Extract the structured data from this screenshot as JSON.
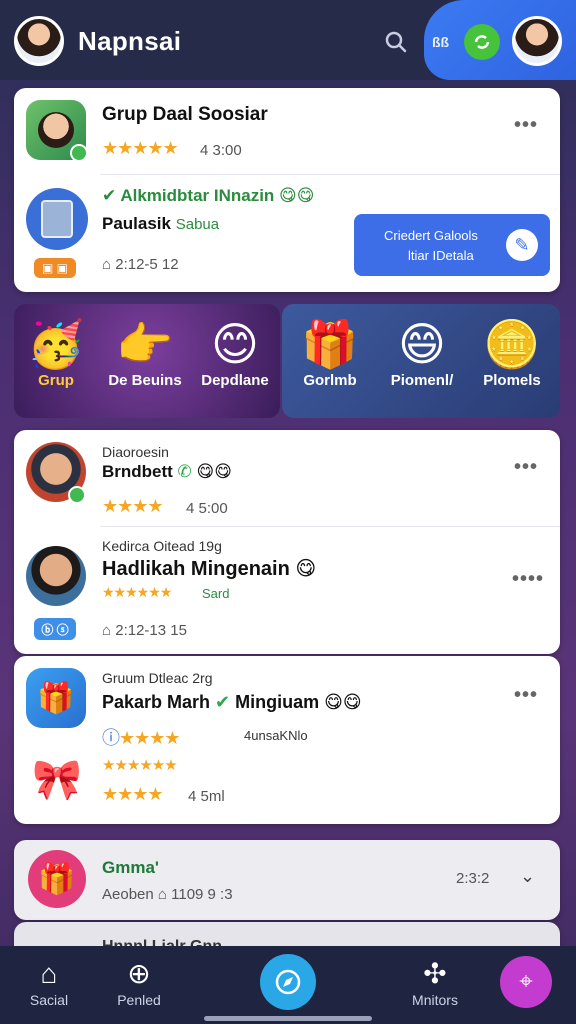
{
  "header": {
    "title": "Napnsai",
    "short_label": "ßß"
  },
  "card1": {
    "row1": {
      "name": "Grup Daal Soosiar",
      "rating_text": "4 3:00",
      "stars": "★★★★★"
    },
    "row2": {
      "title": "Alkmidbtar INnazin",
      "subtitle": "Paulasik",
      "subtitle_tag": "Sabua",
      "meta": "2:12-5 12",
      "cta_line1": "Criedert Galools",
      "cta_line2": "ltiar IDetala"
    }
  },
  "banner": {
    "left_items": [
      {
        "label": "Grup",
        "icon": "party-emoji-icon"
      },
      {
        "label": "De Beuins",
        "icon": "pointer-emoji-icon"
      },
      {
        "label": "Depdlane",
        "icon": "smile-emoji-icon"
      }
    ],
    "right_items": [
      {
        "label": "Gorlmb",
        "icon": "gift-coin-icon"
      },
      {
        "label": "Piomenl/",
        "icon": "happy-emoji-icon"
      },
      {
        "label": "Plomels",
        "icon": "coin-icon"
      }
    ]
  },
  "card2": {
    "row1": {
      "small": "Diaoroesin",
      "name": "Brndbett",
      "rating_text": "4 5:00",
      "stars": "★★★★"
    },
    "row2": {
      "small": "Kedirca Oitead 19g",
      "name": "Hadlikah Mingenain",
      "stars": "★★★★★★",
      "tag": "Sard",
      "meta": "2:12-13 15"
    }
  },
  "card3": {
    "small": "Gruum Dtleac 2rg",
    "name": "Pakarb Marh",
    "name2": "Mingiuam",
    "tag": "4unsaKNlo",
    "stars_a": "★★★★★★",
    "stars_b": "★★★★",
    "rating_text": "4 5ml"
  },
  "card4": {
    "name": "Gmma'",
    "sub": "Aeoben",
    "sub_val": "1109 9 :3",
    "time": "2:3:2"
  },
  "card5": {
    "name": "Hnnnl Lialr Gnn"
  },
  "nav": {
    "items": [
      "Sacial",
      "Penled",
      "",
      "Mnitors"
    ]
  }
}
